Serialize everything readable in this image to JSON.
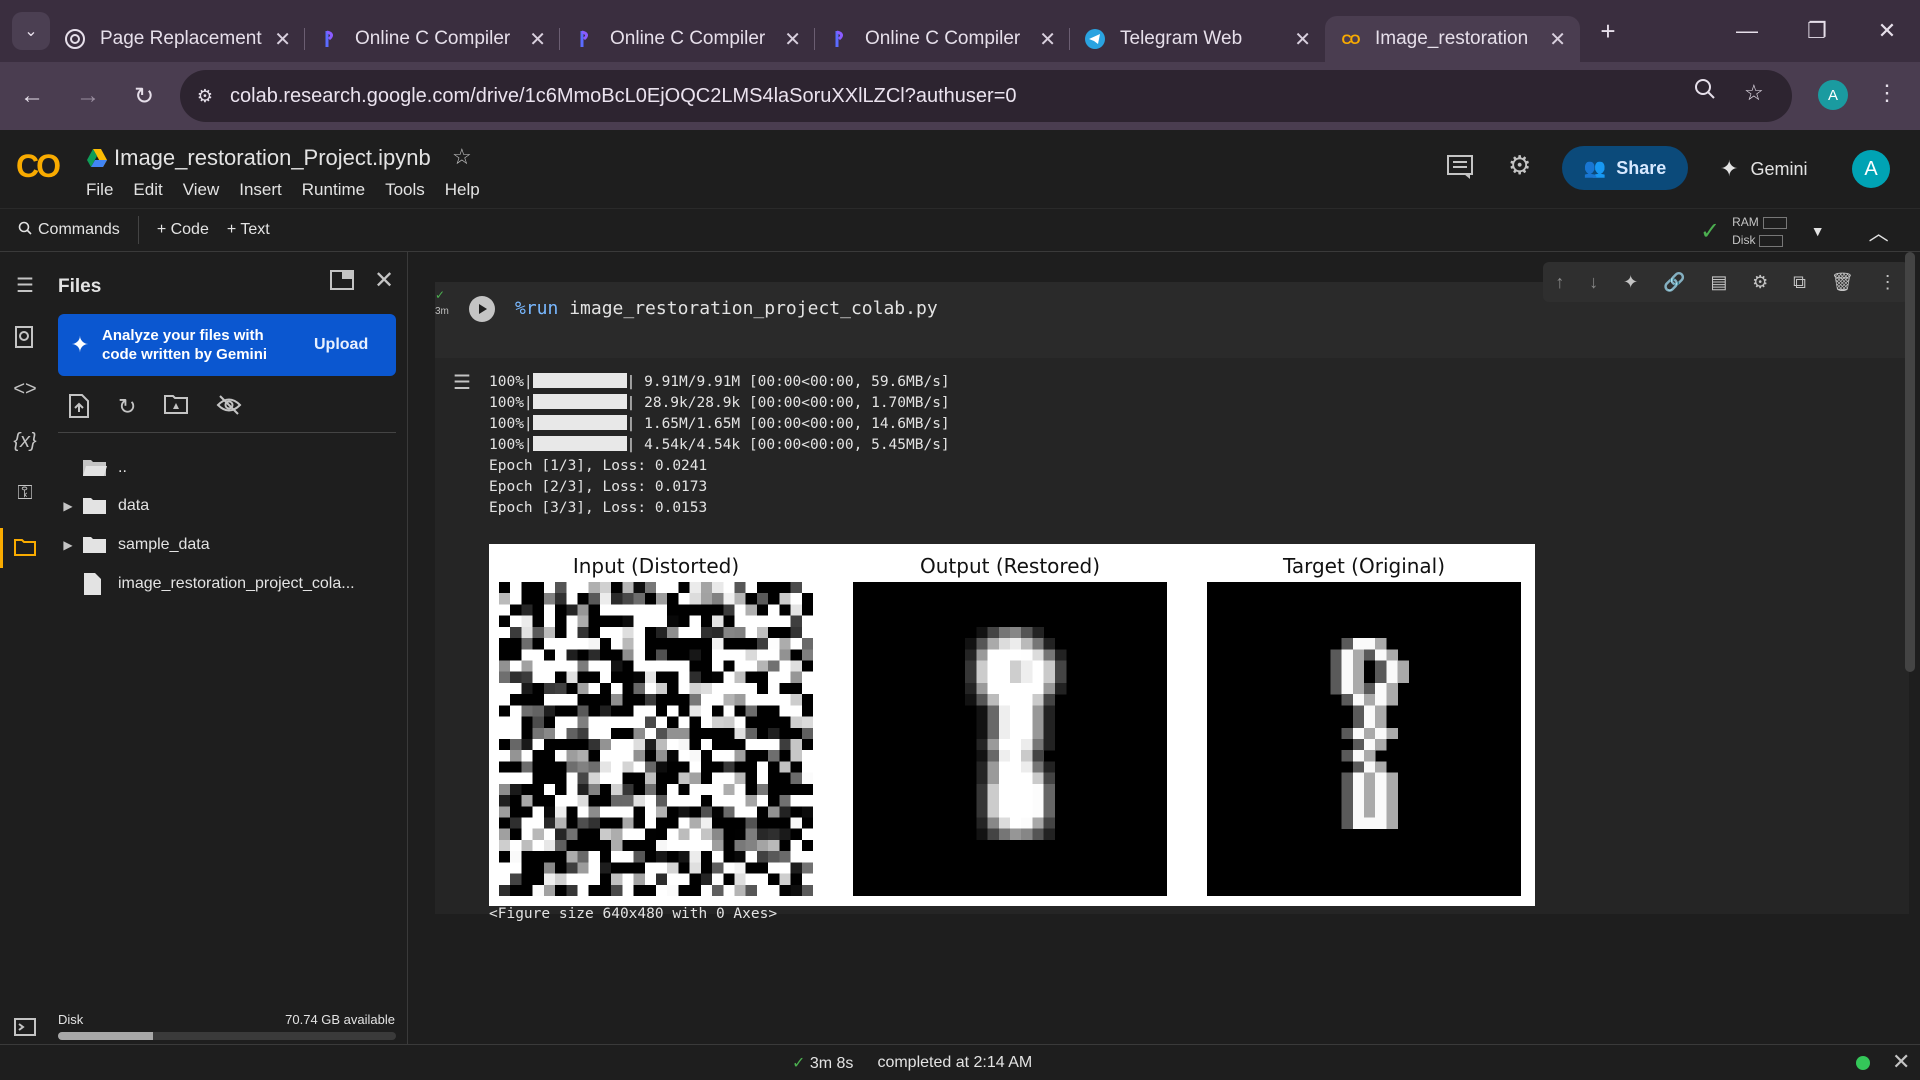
{
  "browser": {
    "tabs": [
      {
        "title": "Page Replacement",
        "icon": "openai-icon"
      },
      {
        "title": "Online C Compiler",
        "icon": "compiler-icon"
      },
      {
        "title": "Online C Compiler",
        "icon": "compiler-icon"
      },
      {
        "title": "Online C Compiler",
        "icon": "compiler-icon"
      },
      {
        "title": "Telegram Web",
        "icon": "telegram-icon"
      },
      {
        "title": "Image_restoration",
        "icon": "colab-icon",
        "active": true
      }
    ],
    "url": "colab.research.google.com/drive/1c6MmoBcL0EjOQC2LMS4laSoruXXlLZCl?authuser=0",
    "profile_initial": "A"
  },
  "header": {
    "logo": "CO",
    "notebook_title": "Image_restoration_Project.ipynb",
    "menu": [
      "File",
      "Edit",
      "View",
      "Insert",
      "Runtime",
      "Tools",
      "Help"
    ],
    "share_label": "Share",
    "gemini_label": "Gemini",
    "avatar_initial": "A"
  },
  "toolbar": {
    "commands_label": "Commands",
    "code_label": "+ Code",
    "text_label": "+ Text",
    "ram_label": "RAM",
    "disk_label": "Disk"
  },
  "files_panel": {
    "title": "Files",
    "banner_text": "Analyze your files with code written by Gemini",
    "upload_label": "Upload",
    "tree": [
      {
        "name": "..",
        "type": "parent"
      },
      {
        "name": "data",
        "type": "folder"
      },
      {
        "name": "sample_data",
        "type": "folder"
      },
      {
        "name": "image_restoration_project_cola...",
        "type": "file"
      }
    ],
    "disk_label": "Disk",
    "disk_available": "70.74 GB available",
    "disk_used_fraction": 0.28
  },
  "cell": {
    "run_time": "3m",
    "code_magic": "%run",
    "code_rest": " image_restoration_project_colab.py",
    "progress_lines": [
      {
        "pct": "100%",
        "info": " 9.91M/9.91M [00:00<00:00, 59.6MB/s]"
      },
      {
        "pct": "100%",
        "info": " 28.9k/28.9k [00:00<00:00, 1.70MB/s]"
      },
      {
        "pct": "100%",
        "info": " 1.65M/1.65M [00:00<00:00, 14.6MB/s]"
      },
      {
        "pct": "100%",
        "info": " 4.54k/4.54k [00:00<00:00, 5.45MB/s]"
      }
    ],
    "epoch_lines": [
      "Epoch [1/3], Loss: 0.0241",
      "Epoch [2/3], Loss: 0.0173",
      "Epoch [3/3], Loss: 0.0153"
    ],
    "figure_titles": [
      "Input (Distorted)",
      "Output (Restored)",
      "Target (Original)"
    ],
    "figure_size_text": "<Figure size 640x480 with 0 Axes>"
  },
  "status": {
    "elapsed": "3m 8s",
    "completed": "completed at 2:14 AM"
  },
  "colors": {
    "colab_orange": "#f9ab00",
    "share_blue": "#0b4a7a",
    "banner_blue": "#0b57d0",
    "status_green": "#34c759"
  }
}
